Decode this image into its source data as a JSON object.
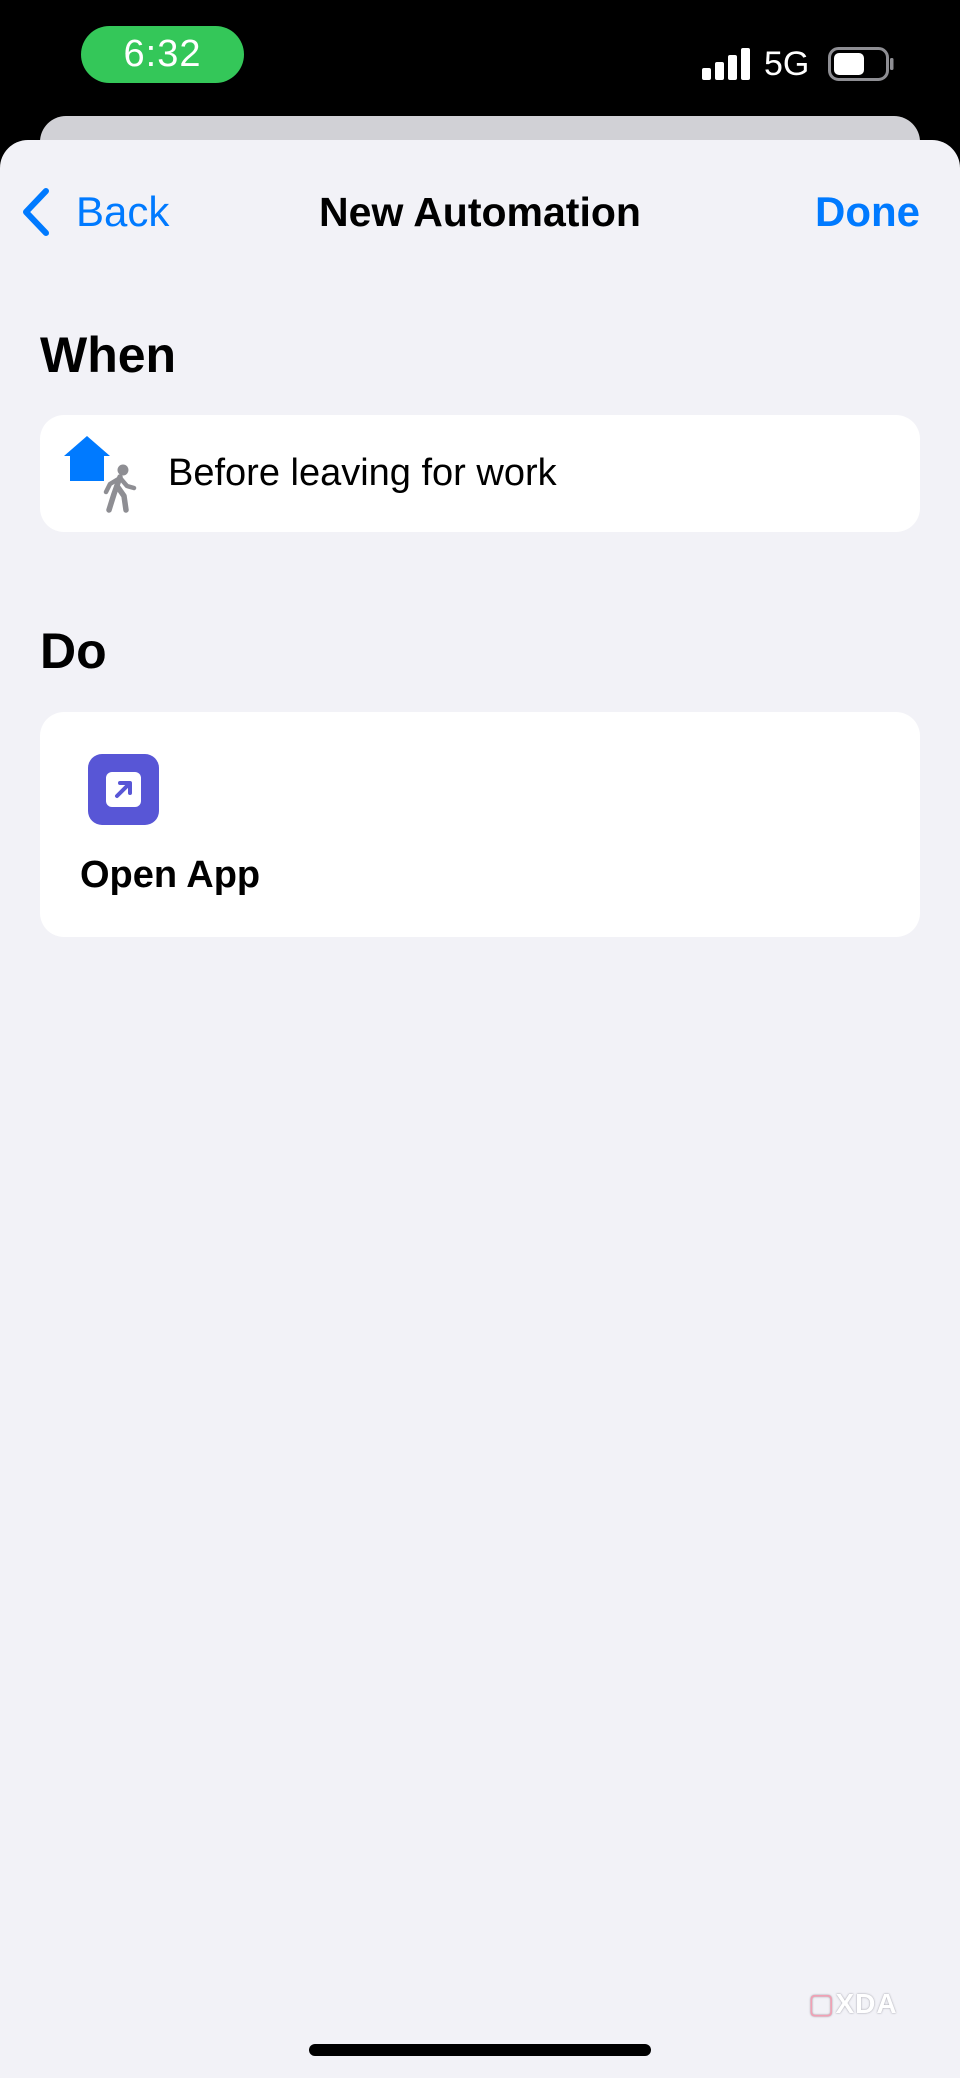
{
  "status_bar": {
    "time": "6:32",
    "network": "5G",
    "time_pill_color": "#34c759",
    "signal_icon": "cellular-signal-icon",
    "battery_icon": "battery-icon"
  },
  "nav": {
    "back_label": "Back",
    "title": "New Automation",
    "done_label": "Done",
    "accent_color": "#007aff",
    "back_icon": "chevron-left-icon"
  },
  "when_section": {
    "heading": "When",
    "trigger": {
      "label": "Before leaving for work",
      "icon": "home-departure-icon"
    }
  },
  "do_section": {
    "heading": "Do",
    "action": {
      "label": "Open App",
      "icon": "open-app-icon",
      "icon_color": "#5856d6"
    }
  },
  "watermark": {
    "text": "XDA",
    "icon": "xda-logo"
  }
}
